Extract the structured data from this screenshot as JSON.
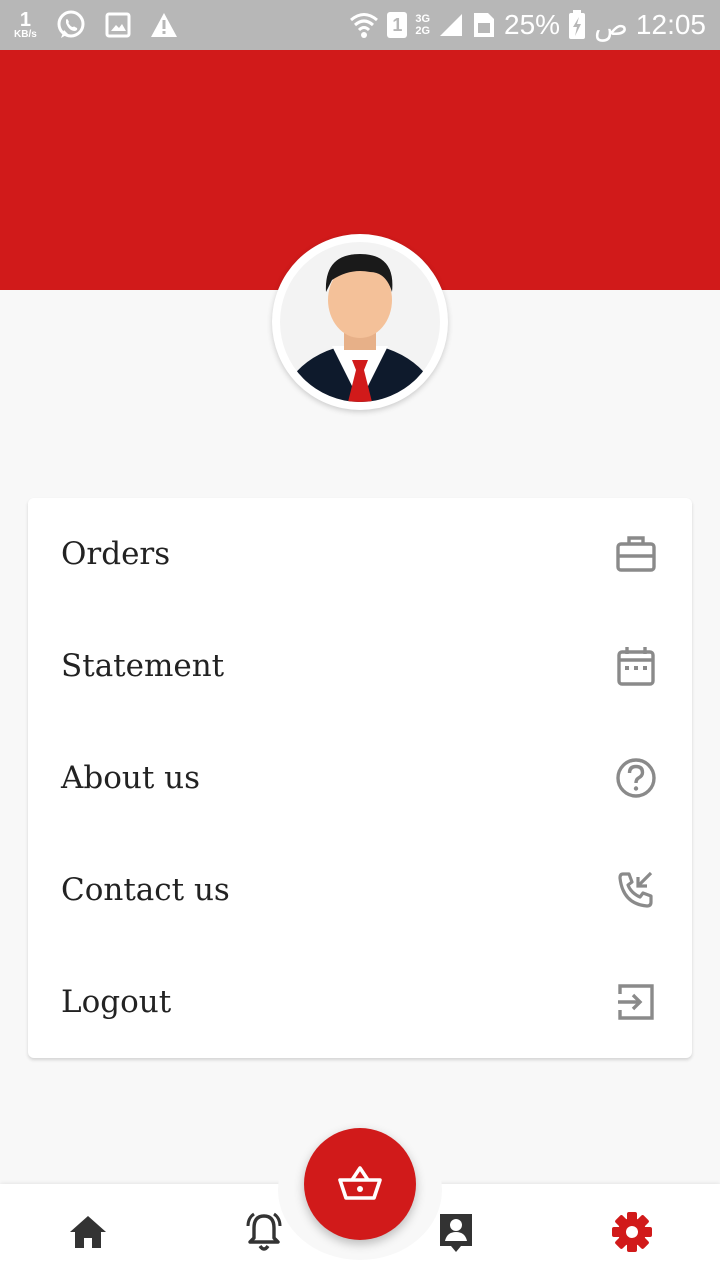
{
  "status_bar": {
    "speed_value": "1",
    "speed_unit": "KB/s",
    "sim_slot": "1",
    "network_top": "3G",
    "network_bottom": "2G",
    "battery": "25%",
    "time": "12:05",
    "ampm": "ص"
  },
  "colors": {
    "accent": "#d11a1a",
    "status_bar": "#b7b7b7",
    "icon_gray": "#8a8a8a"
  },
  "menu": {
    "items": [
      {
        "label": "Orders",
        "icon": "briefcase-icon"
      },
      {
        "label": "Statement",
        "icon": "calendar-icon"
      },
      {
        "label": "About us",
        "icon": "help-circle-icon"
      },
      {
        "label": "Contact us",
        "icon": "phone-incoming-icon"
      },
      {
        "label": "Logout",
        "icon": "logout-icon"
      }
    ]
  },
  "bottom_nav": {
    "items": [
      "home-icon",
      "bell-icon",
      "basket-icon",
      "profile-icon",
      "settings-icon"
    ],
    "active": "settings-icon"
  }
}
